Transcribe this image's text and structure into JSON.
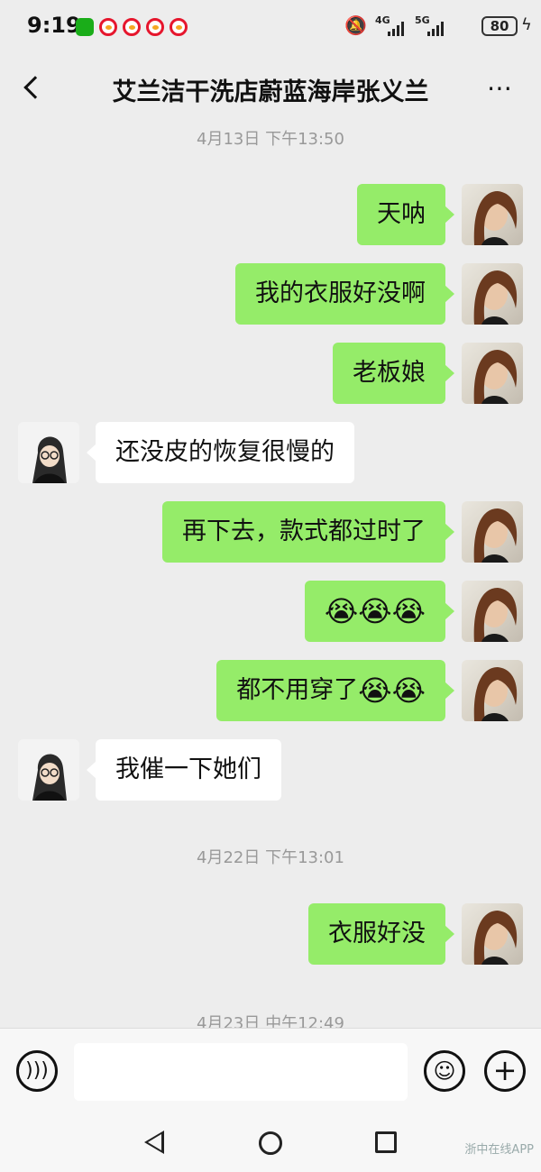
{
  "status_bar": {
    "time": "9:19",
    "network_1": "4G",
    "network_2": "5G",
    "battery": "80",
    "icons": [
      "wechat-icon",
      "weibo-icon",
      "weibo-icon",
      "weibo-icon",
      "weibo-icon",
      "mute-bell-icon",
      "signal-icon",
      "signal-icon",
      "battery-icon",
      "charging-icon"
    ]
  },
  "header": {
    "title": "艾兰洁干洗店蔚蓝海岸张义兰",
    "more": "⋯"
  },
  "chat": {
    "timestamps": [
      "4月13日 下午13:50",
      "4月22日 下午13:01",
      "4月23日 中午12:49"
    ],
    "messages": [
      {
        "side": "right",
        "text": "天呐"
      },
      {
        "side": "right",
        "text": "我的衣服好没啊"
      },
      {
        "side": "right",
        "text": "老板娘"
      },
      {
        "side": "left",
        "text": "还没皮的恢复很慢的"
      },
      {
        "side": "right",
        "text": "再下去，款式都过时了"
      },
      {
        "side": "right",
        "text": "",
        "emoji": "😭😭😭"
      },
      {
        "side": "right",
        "text": "都不用穿了",
        "emoji": "😭😭"
      },
      {
        "side": "left",
        "text": "我催一下她们"
      },
      {
        "side": "right",
        "text": "衣服好没"
      }
    ]
  },
  "input_bar": {
    "voice_icon": "voice-icon",
    "emoji_icon": "emoji-icon",
    "plus_icon": "plus-icon",
    "placeholder": ""
  },
  "nav": {
    "watermark": "浙中在线APP"
  },
  "colors": {
    "background": "#ededed",
    "bubble_sent": "#95ec69",
    "bubble_received": "#ffffff",
    "timestamp": "#999999"
  }
}
